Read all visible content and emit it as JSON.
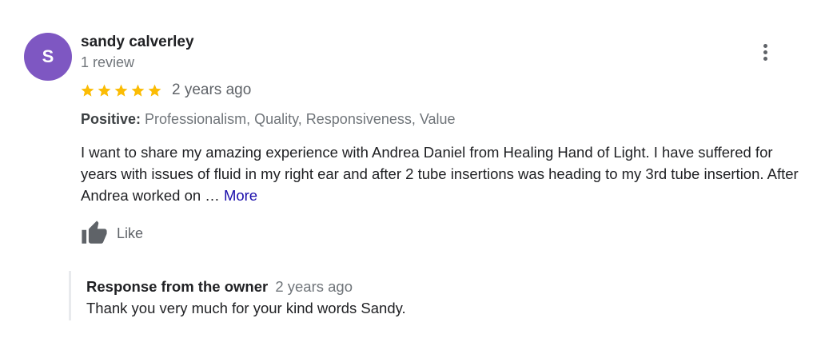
{
  "review": {
    "avatar_letter": "S",
    "avatar_color": "#7e57c2",
    "author": "sandy calverley",
    "review_count": "1 review",
    "rating": 5,
    "rating_max": 5,
    "star_color": "#fbbc04",
    "date": "2 years ago",
    "attributes_label": "Positive:",
    "attributes_values": "Professionalism, Quality, Responsiveness, Value",
    "text": "I want to share my amazing experience with Andrea Daniel from Healing Hand of Light. I have suffered for years with issues of fluid in my right ear and after 2 tube insertions was heading to my 3rd tube insertion. After Andrea worked on … ",
    "more_label": "More",
    "like_label": "Like",
    "menu_icon": "more-vert-icon"
  },
  "owner_response": {
    "title": "Response from the owner",
    "date": "2 years ago",
    "text": "Thank you very much for your kind words Sandy."
  },
  "colors": {
    "link": "#1a0dab",
    "muted": "#70757a",
    "text": "#202124"
  }
}
